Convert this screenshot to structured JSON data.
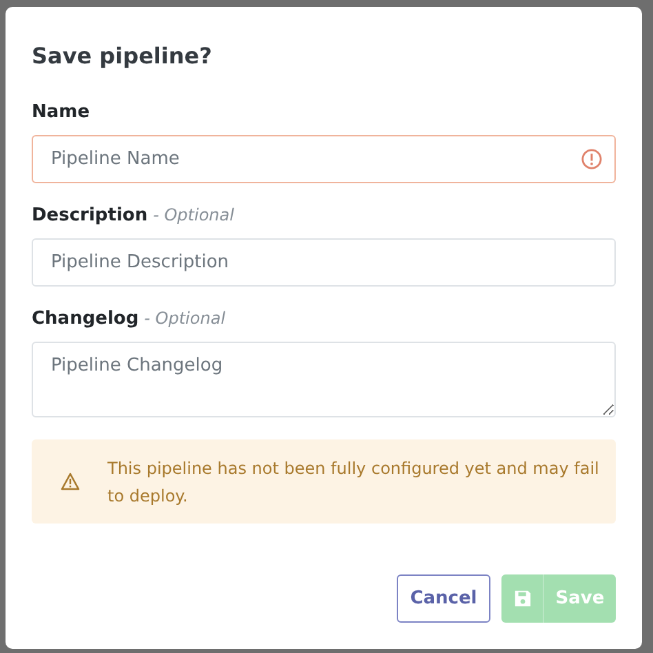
{
  "dialog": {
    "title": "Save pipeline?",
    "fields": [
      {
        "kind": "input",
        "label": "Name",
        "placeholder": "Pipeline Name",
        "invalid": true
      },
      {
        "kind": "input",
        "label": "Description",
        "hint": "- Optional",
        "placeholder": "Pipeline Description",
        "invalid": false
      },
      {
        "kind": "textarea",
        "label": "Changelog",
        "hint": "- Optional",
        "placeholder": "Pipeline Changelog",
        "invalid": false
      }
    ],
    "warning": "This pipeline has not been fully configured yet and may fail to deploy.",
    "buttons": [
      {
        "kind": "secondary",
        "label": "Cancel",
        "disabled": false
      },
      {
        "kind": "primary",
        "label": "Save",
        "disabled": true
      }
    ]
  }
}
